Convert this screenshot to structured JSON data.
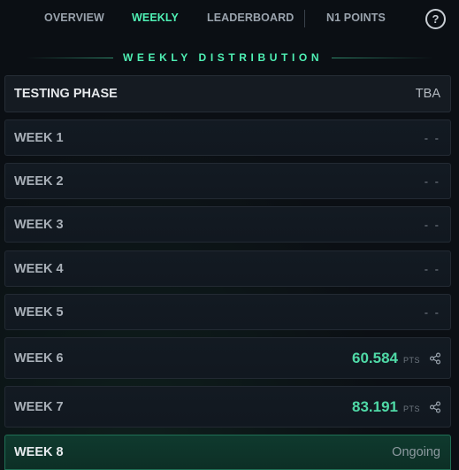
{
  "nav": {
    "items": [
      {
        "label": "OVERVIEW",
        "active": false
      },
      {
        "label": "WEEKLY",
        "active": true
      },
      {
        "label": "LEADERBOARD",
        "active": false
      },
      {
        "label": "N1 POINTS",
        "active": false
      }
    ],
    "help_icon": "question-circle-icon",
    "help_glyph": "?"
  },
  "section": {
    "title": "WEEKLY DISTRIBUTION"
  },
  "rows": [
    {
      "label": "TESTING PHASE",
      "value": "TBA",
      "type": "text"
    },
    {
      "label": "WEEK 1",
      "value": "- -",
      "type": "pending"
    },
    {
      "label": "WEEK 2",
      "value": "- -",
      "type": "pending"
    },
    {
      "label": "WEEK 3",
      "value": "- -",
      "type": "pending"
    },
    {
      "label": "WEEK 4",
      "value": "- -",
      "type": "pending"
    },
    {
      "label": "WEEK 5",
      "value": "- -",
      "type": "pending"
    },
    {
      "label": "WEEK 6",
      "points": "60.584",
      "unit": "PTS",
      "share_icon": "share-icon",
      "type": "points"
    },
    {
      "label": "WEEK 7",
      "points": "83.191",
      "unit": "PTS",
      "share_icon": "share-icon",
      "type": "points"
    },
    {
      "label": "WEEK 8",
      "value": "Ongoing",
      "type": "current"
    }
  ],
  "colors": {
    "accent": "#4ff0b4",
    "points": "#4fd9a6",
    "background": "#0b0f14",
    "row_bg": "#131a22",
    "current_bg": "#0f3a2e"
  }
}
